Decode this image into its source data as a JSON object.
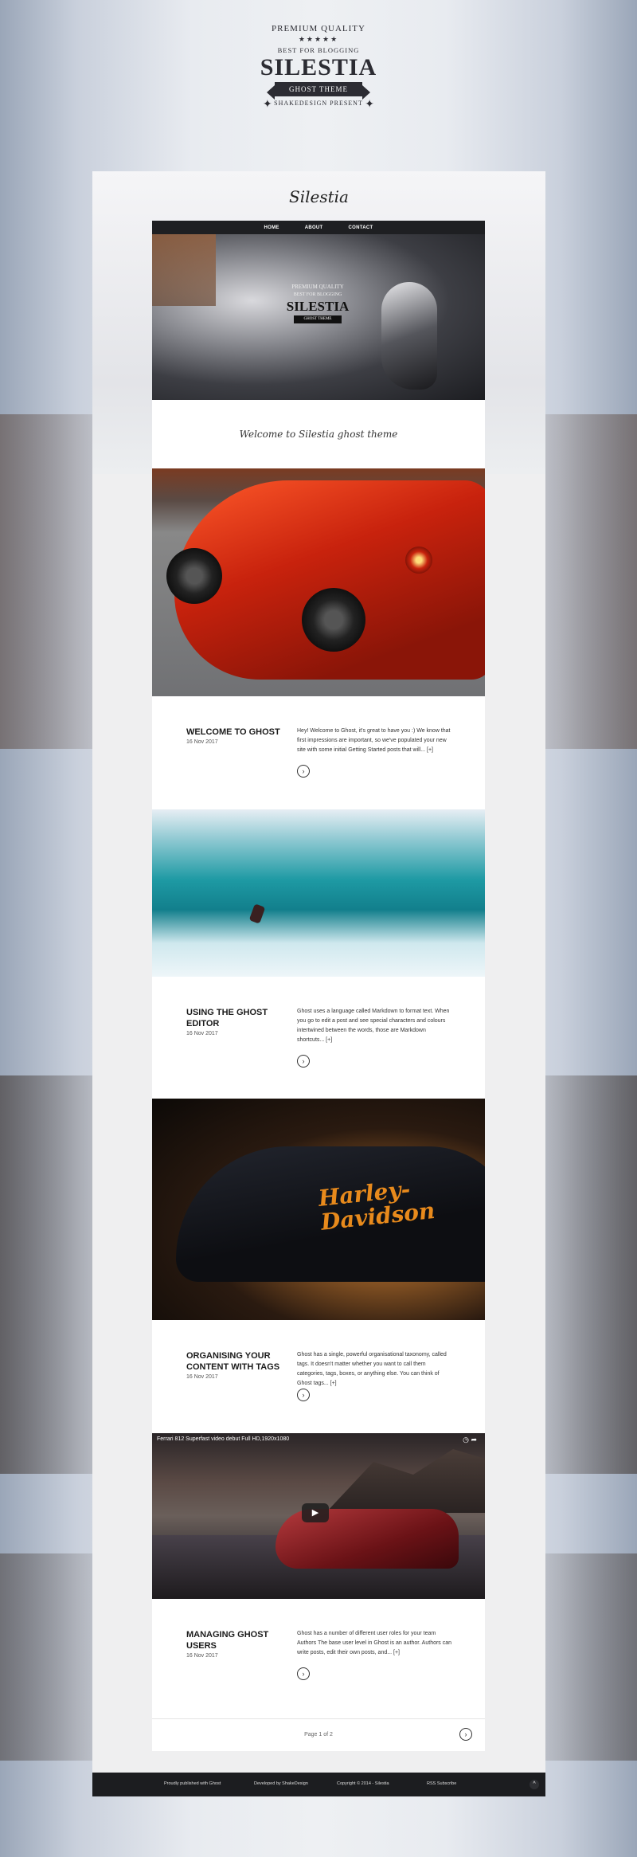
{
  "emblem": {
    "top": "PREMIUM QUALITY",
    "stars": "★★★★★",
    "tagline": "BEST FOR BLOGGING",
    "name": "SILESTIA",
    "ribbon": "GHOST THEME",
    "presents": "SHAKEDESIGN PRESENT"
  },
  "blog": {
    "name": "Silestia"
  },
  "nav": {
    "items": [
      "HOME",
      "ABOUT",
      "CONTACT"
    ]
  },
  "hero": {
    "top": "PREMIUM QUALITY",
    "tagline": "BEST FOR BLOGGING",
    "name": "SILESTIA",
    "ribbon": "GHOST THEME"
  },
  "welcome": "Welcome to Silestia ghost theme",
  "posts": [
    {
      "title": "WELCOME TO GHOST",
      "date": "16 Nov 2017",
      "excerpt": "Hey! Welcome to Ghost, it's great to have you :) We know that first impressions are important, so we've populated your new site with some initial Getting Started posts that will... [+]",
      "more": "›"
    },
    {
      "title": "USING THE GHOST EDITOR",
      "date": "16 Nov 2017",
      "excerpt": "Ghost uses a language called Markdown to format text. When you go to edit a post and see special characters and colours intertwined between the words, those are Markdown shortcuts... [+]",
      "more": "›"
    },
    {
      "title": "ORGANISING YOUR CONTENT WITH TAGS",
      "date": "16 Nov 2017",
      "excerpt": "Ghost has a single, powerful organisational taxonomy, called tags. It doesn't matter whether you want to call them categories, tags, boxes, or anything else. You can think of Ghost tags... [+]",
      "more": "›"
    },
    {
      "title": "MANAGING GHOST USERS",
      "date": "16 Nov 2017",
      "excerpt": "Ghost has a number of different user roles for your team Authors The base user level in Ghost is an author. Authors can write posts, edit their own posts, and... [+]",
      "more": "›"
    }
  ],
  "img3_logo": "Harley-Davidson",
  "video": {
    "title": "Ferrari 812 Superfast video debut Full HD,1920x1080",
    "icons": "◷  ➦",
    "play": "▶"
  },
  "pager": {
    "text": "Page 1 of 2",
    "next": "›"
  },
  "footer": {
    "published": "Proudly published with  Ghost",
    "developed": "Developed by  ShakeDesign",
    "copyright": "Copyright © 2014 - Silestia",
    "rss": "RSS Subscribe",
    "up": "^"
  }
}
